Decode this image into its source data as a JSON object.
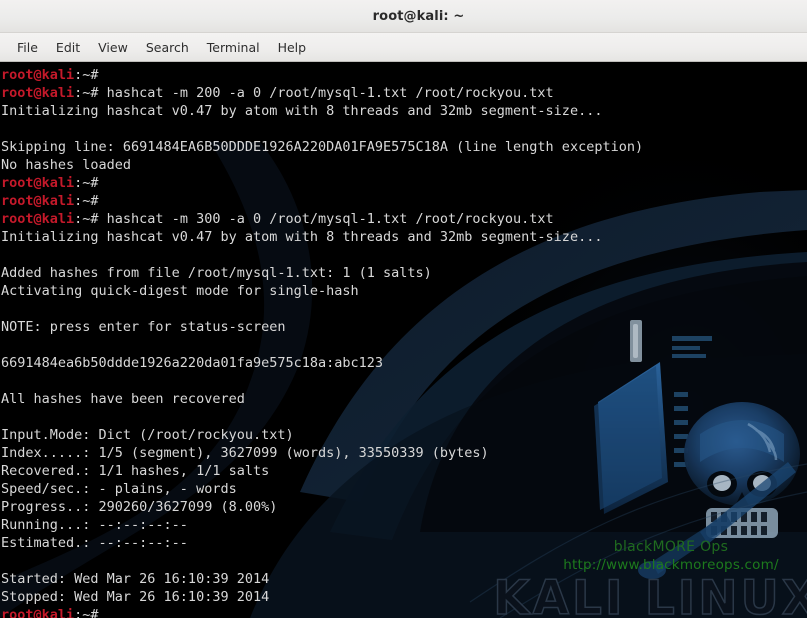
{
  "window": {
    "title": "root@kali: ~"
  },
  "menubar": {
    "items": [
      {
        "label": "File"
      },
      {
        "label": "Edit"
      },
      {
        "label": "View"
      },
      {
        "label": "Search"
      },
      {
        "label": "Terminal"
      },
      {
        "label": "Help"
      }
    ]
  },
  "terminal": {
    "prompt_user_host": "root@kali",
    "prompt_tail": ":~#",
    "colors": {
      "background": "#000000",
      "foreground": "#d8d8d8",
      "prompt_red": "#c4192a"
    },
    "lines": [
      {
        "type": "prompt",
        "command": ""
      },
      {
        "type": "prompt",
        "command": " hashcat -m 200 -a 0 /root/mysql-1.txt /root/rockyou.txt"
      },
      {
        "type": "output",
        "text": "Initializing hashcat v0.47 by atom with 8 threads and 32mb segment-size..."
      },
      {
        "type": "blank",
        "text": ""
      },
      {
        "type": "output",
        "text": "Skipping line: 6691484EA6B50DDDE1926A220DA01FA9E575C18A (line length exception)"
      },
      {
        "type": "output",
        "text": "No hashes loaded"
      },
      {
        "type": "prompt",
        "command": ""
      },
      {
        "type": "prompt",
        "command": ""
      },
      {
        "type": "prompt",
        "command": " hashcat -m 300 -a 0 /root/mysql-1.txt /root/rockyou.txt"
      },
      {
        "type": "output",
        "text": "Initializing hashcat v0.47 by atom with 8 threads and 32mb segment-size..."
      },
      {
        "type": "blank",
        "text": ""
      },
      {
        "type": "output",
        "text": "Added hashes from file /root/mysql-1.txt: 1 (1 salts)"
      },
      {
        "type": "output",
        "text": "Activating quick-digest mode for single-hash"
      },
      {
        "type": "blank",
        "text": ""
      },
      {
        "type": "output",
        "text": "NOTE: press enter for status-screen"
      },
      {
        "type": "blank",
        "text": ""
      },
      {
        "type": "output",
        "text": "6691484ea6b50ddde1926a220da01fa9e575c18a:abc123"
      },
      {
        "type": "blank",
        "text": ""
      },
      {
        "type": "output",
        "text": "All hashes have been recovered"
      },
      {
        "type": "blank",
        "text": ""
      },
      {
        "type": "output",
        "text": "Input.Mode: Dict (/root/rockyou.txt)"
      },
      {
        "type": "output",
        "text": "Index.....: 1/5 (segment), 3627099 (words), 33550339 (bytes)"
      },
      {
        "type": "output",
        "text": "Recovered.: 1/1 hashes, 1/1 salts"
      },
      {
        "type": "output",
        "text": "Speed/sec.: - plains, - words"
      },
      {
        "type": "output",
        "text": "Progress..: 290260/3627099 (8.00%)"
      },
      {
        "type": "output",
        "text": "Running...: --:--:--:--"
      },
      {
        "type": "output",
        "text": "Estimated.: --:--:--:--"
      },
      {
        "type": "blank",
        "text": ""
      },
      {
        "type": "output",
        "text": "Started: Wed Mar 26 16:10:39 2014"
      },
      {
        "type": "output",
        "text": "Stopped: Wed Mar 26 16:10:39 2014"
      },
      {
        "type": "prompt",
        "command": ""
      }
    ]
  },
  "watermark": {
    "name": "blackMORE Ops",
    "url": "http://www.blackmoreops.com/",
    "logo_text": "KALI LINUX"
  }
}
